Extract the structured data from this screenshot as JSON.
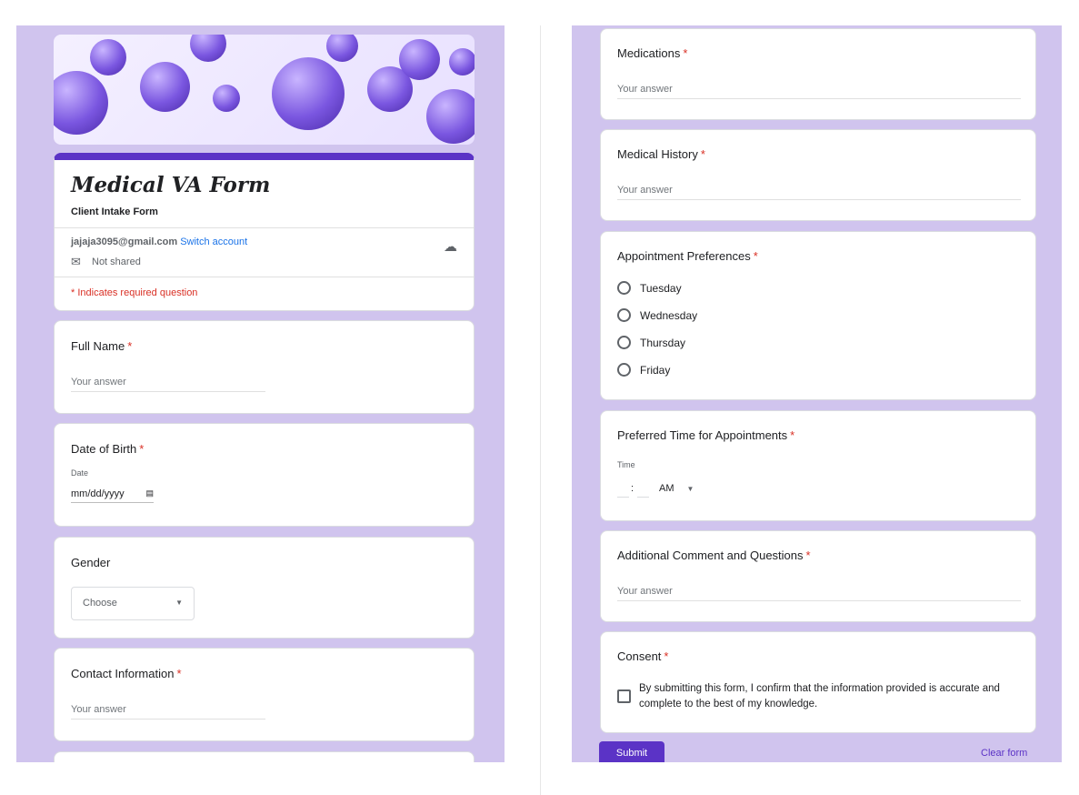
{
  "header": {
    "title": "Medical VA Form",
    "subtitle": "Client Intake Form",
    "email": "jajaja3095@gmail.com",
    "switch_account": "Switch account",
    "not_shared": "Not shared",
    "required_note": "* Indicates required question"
  },
  "questions": {
    "full_name": {
      "label": "Full Name",
      "required": "*",
      "placeholder": "Your answer"
    },
    "dob": {
      "label": "Date of Birth",
      "required": "*",
      "sublabel": "Date",
      "placeholder": "mm/dd/yyyy"
    },
    "gender": {
      "label": "Gender",
      "select": "Choose"
    },
    "contact": {
      "label": "Contact Information",
      "required": "*",
      "placeholder": "Your answer"
    },
    "medications": {
      "label": "Medications",
      "required": "*",
      "placeholder": "Your answer"
    },
    "history": {
      "label": "Medical History",
      "required": "*",
      "placeholder": "Your answer"
    },
    "appointment": {
      "label": "Appointment Preferences",
      "required": "*",
      "options": [
        "Tuesday",
        "Wednesday",
        "Thursday",
        "Friday"
      ]
    },
    "time": {
      "label": "Preferred Time for Appointments",
      "required": "*",
      "sublabel": "Time",
      "colon": ":",
      "ampm": "AM"
    },
    "comments": {
      "label": "Additional Comment and Questions",
      "required": "*",
      "placeholder": "Your answer"
    },
    "consent": {
      "label": "Consent",
      "required": "*",
      "text": "By submitting this form, I confirm that the information provided is accurate and complete to the best of my knowledge."
    }
  },
  "actions": {
    "submit": "Submit",
    "clear": "Clear form"
  },
  "colors": {
    "accent": "#5b33c6",
    "background": "#d0c4ee",
    "required": "#d93025",
    "link": "#1a73e8"
  }
}
